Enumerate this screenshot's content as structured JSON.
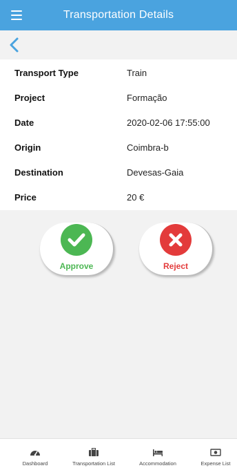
{
  "header": {
    "title": "Transportation Details"
  },
  "details": [
    {
      "label": "Transport Type",
      "value": "Train"
    },
    {
      "label": "Project",
      "value": "Formação"
    },
    {
      "label": "Date",
      "value": "2020-02-06 17:55:00"
    },
    {
      "label": "Origin",
      "value": "Coimbra-b"
    },
    {
      "label": "Destination",
      "value": "Devesas-Gaia"
    },
    {
      "label": "Price",
      "value": "20 €"
    }
  ],
  "actions": {
    "approve_label": "Approve",
    "reject_label": "Reject"
  },
  "tabs": [
    {
      "label": "Dashboard",
      "icon": "dashboard-icon"
    },
    {
      "label": "Transportation List",
      "icon": "briefcase-icon"
    },
    {
      "label": "Accommodation",
      "icon": "bed-icon"
    },
    {
      "label": "Expense List",
      "icon": "money-icon"
    }
  ],
  "colors": {
    "appbar": "#4aa3df",
    "approve": "#4cb753",
    "reject": "#e33b3b"
  }
}
